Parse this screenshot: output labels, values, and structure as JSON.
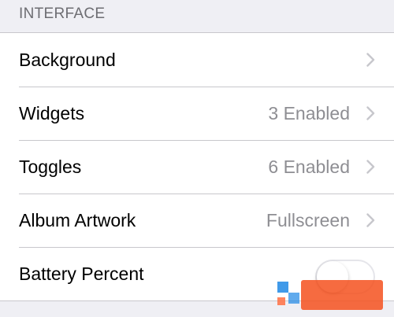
{
  "section": {
    "title": "INTERFACE"
  },
  "rows": [
    {
      "label": "Background",
      "value": "",
      "control": "chevron"
    },
    {
      "label": "Widgets",
      "value": "3 Enabled",
      "control": "chevron"
    },
    {
      "label": "Toggles",
      "value": "6 Enabled",
      "control": "chevron"
    },
    {
      "label": "Album Artwork",
      "value": "Fullscreen",
      "control": "chevron"
    },
    {
      "label": "Battery Percent",
      "value": "",
      "control": "toggle",
      "toggle_on": false
    }
  ],
  "colors": {
    "background": "#efeff4",
    "cell": "#ffffff",
    "separator": "#c8c7cc",
    "header_text": "#6d6d72",
    "value_text": "#8e8e93",
    "chevron": "#c7c7cc"
  },
  "icons": {
    "chevron": "chevron-right-icon",
    "watermark": "watermark-logo"
  }
}
